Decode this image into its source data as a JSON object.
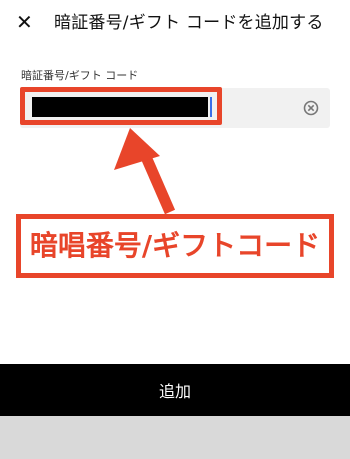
{
  "header": {
    "close_glyph": "✕",
    "title": "暗証番号/ギフト コードを追加する"
  },
  "form": {
    "field_label": "暗証番号/ギフト コード",
    "input_value_masked": true,
    "clear_icon": "clear-circle-icon"
  },
  "annotation": {
    "callout_text": "暗唱番号/ギフトコード",
    "color": "#e8452a"
  },
  "footer": {
    "add_label": "追加"
  }
}
